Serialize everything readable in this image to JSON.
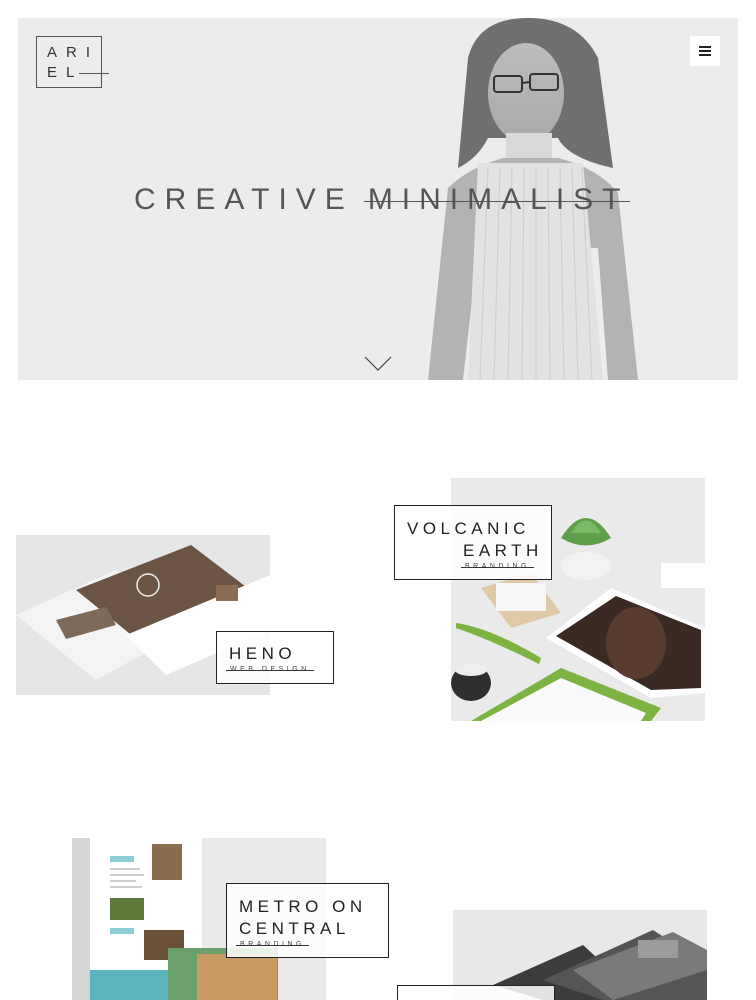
{
  "brand": {
    "logo_line1": "ARI",
    "logo_line2": "EL"
  },
  "hero": {
    "headline_plain": "CREATIVE",
    "headline_struck": "MINIMALIST"
  },
  "projects": [
    {
      "title_line1": "HENO",
      "title_line2": "",
      "category": "WEB DESIGN"
    },
    {
      "title_line1": "VOLCANIC",
      "title_line2": "EARTH",
      "category": "BRANDING"
    },
    {
      "title_line1": "METRO ON",
      "title_line2": "CENTRAL",
      "category": "BRANDING"
    }
  ],
  "colors": {
    "hero_bg": "#ececec",
    "page_bg": "#ffffff",
    "text": "#222222",
    "accent_green": "#7cb342",
    "accent_teal": "#5bb4be"
  },
  "icons": {
    "menu": "hamburger-icon",
    "scroll": "chevron-down-icon"
  }
}
